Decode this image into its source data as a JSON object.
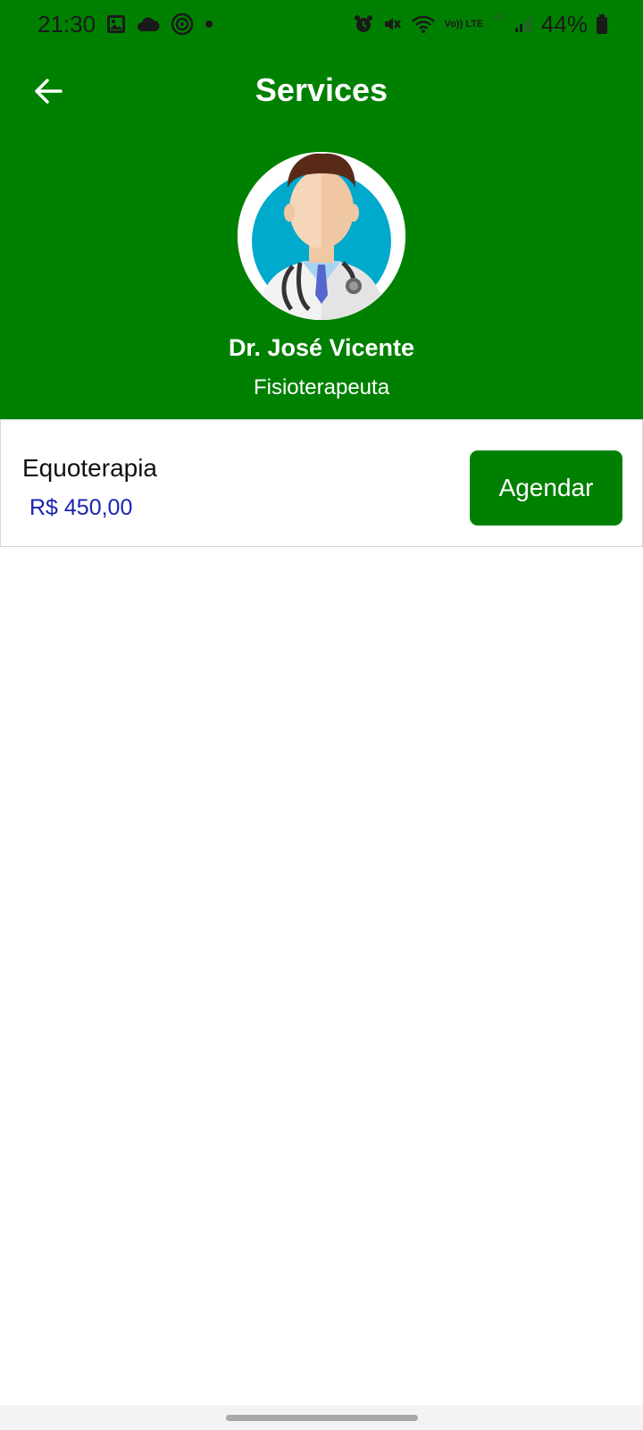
{
  "status_bar": {
    "time": "21:30",
    "left_icons": [
      "image-icon",
      "cloud-icon",
      "at-sign-icon",
      "dot-icon"
    ],
    "volte_label": "Vo)) LTE",
    "network_label": "4G",
    "battery": "44%"
  },
  "header": {
    "title": "Services",
    "back_icon": "arrow-left-icon",
    "background": "#008000"
  },
  "doctor": {
    "name": "Dr. José Vicente",
    "role": "Fisioterapeuta"
  },
  "services": [
    {
      "name": "Equoterapia",
      "price": "R$ 450,00",
      "action_label": "Agendar"
    }
  ],
  "colors": {
    "primary": "#008000",
    "price": "#1a23b0",
    "avatar_ring": "#00aacc"
  }
}
